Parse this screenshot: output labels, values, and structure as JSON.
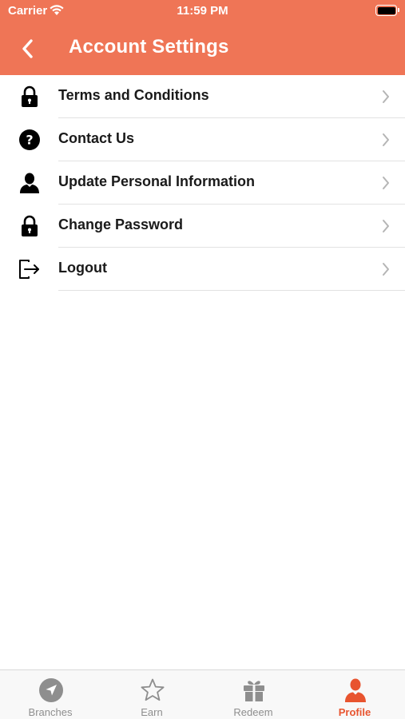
{
  "status_bar": {
    "carrier": "Carrier",
    "time": "11:59 PM"
  },
  "header": {
    "title": "Account Settings",
    "back_icon": "chevron-left-icon"
  },
  "menu": {
    "items": [
      {
        "label": "Terms and Conditions",
        "icon": "lock-icon"
      },
      {
        "label": "Contact Us",
        "icon": "question-circle-icon"
      },
      {
        "label": "Update Personal Information",
        "icon": "person-icon"
      },
      {
        "label": "Change Password",
        "icon": "lock-icon"
      },
      {
        "label": "Logout",
        "icon": "logout-icon"
      }
    ]
  },
  "tabbar": {
    "active": "Profile",
    "tabs": [
      {
        "label": "Branches",
        "icon": "location-arrow-icon"
      },
      {
        "label": "Earn",
        "icon": "star-icon"
      },
      {
        "label": "Redeem",
        "icon": "gift-icon"
      },
      {
        "label": "Profile",
        "icon": "person-icon"
      }
    ]
  },
  "colors": {
    "accent": "#ef7556",
    "active_tab": "#e8542f",
    "inactive_tab": "#8e8e8e"
  }
}
